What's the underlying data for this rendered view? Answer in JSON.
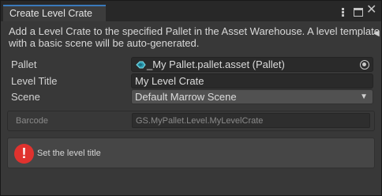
{
  "window": {
    "tab_title": "Create Level Crate",
    "menu_icon": "kebab-menu-icon",
    "maximize_icon": "maximize-icon",
    "close_icon": "close-icon"
  },
  "description": {
    "line1": "Add a Level Crate to the specified Pallet in the Asset Warehouse. A level template",
    "line2": "with a basic scene will be auto-generated."
  },
  "form": {
    "pallet": {
      "label": "Pallet",
      "value": "_My Pallet.pallet.asset (Pallet)",
      "icon": "pallet-asset-icon"
    },
    "level_title": {
      "label": "Level Title",
      "value": "My Level Crate"
    },
    "scene": {
      "label": "Scene",
      "value": "Default Marrow Scene"
    },
    "barcode": {
      "label": "Barcode",
      "value": "GS.MyPallet.Level.MyLevelCrate"
    }
  },
  "help": {
    "icon": "error-icon",
    "message": "Set the level title"
  },
  "colors": {
    "tab_accent": "#3a79bb",
    "error": "#e0322e",
    "background": "#383838"
  }
}
